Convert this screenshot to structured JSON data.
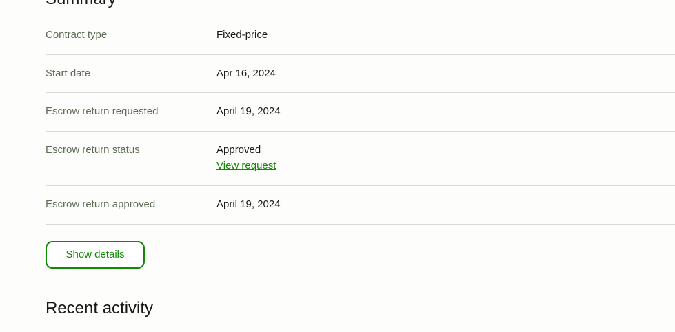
{
  "summary": {
    "title": "Summary",
    "rows": [
      {
        "label": "Contract type",
        "value": "Fixed-price"
      },
      {
        "label": "Start date",
        "value": "Apr 16, 2024"
      },
      {
        "label": "Escrow return requested",
        "value": "April 19, 2024"
      },
      {
        "label": "Escrow return status",
        "value": "Approved",
        "link": "View request"
      },
      {
        "label": "Escrow return approved",
        "value": "April 19, 2024"
      }
    ],
    "show_details_label": "Show details"
  },
  "recent_activity": {
    "title": "Recent activity"
  },
  "colors": {
    "accent": "#108a00",
    "label_text": "#5e6d55",
    "divider": "#d9d9d9",
    "background": "#fdfdfc"
  }
}
